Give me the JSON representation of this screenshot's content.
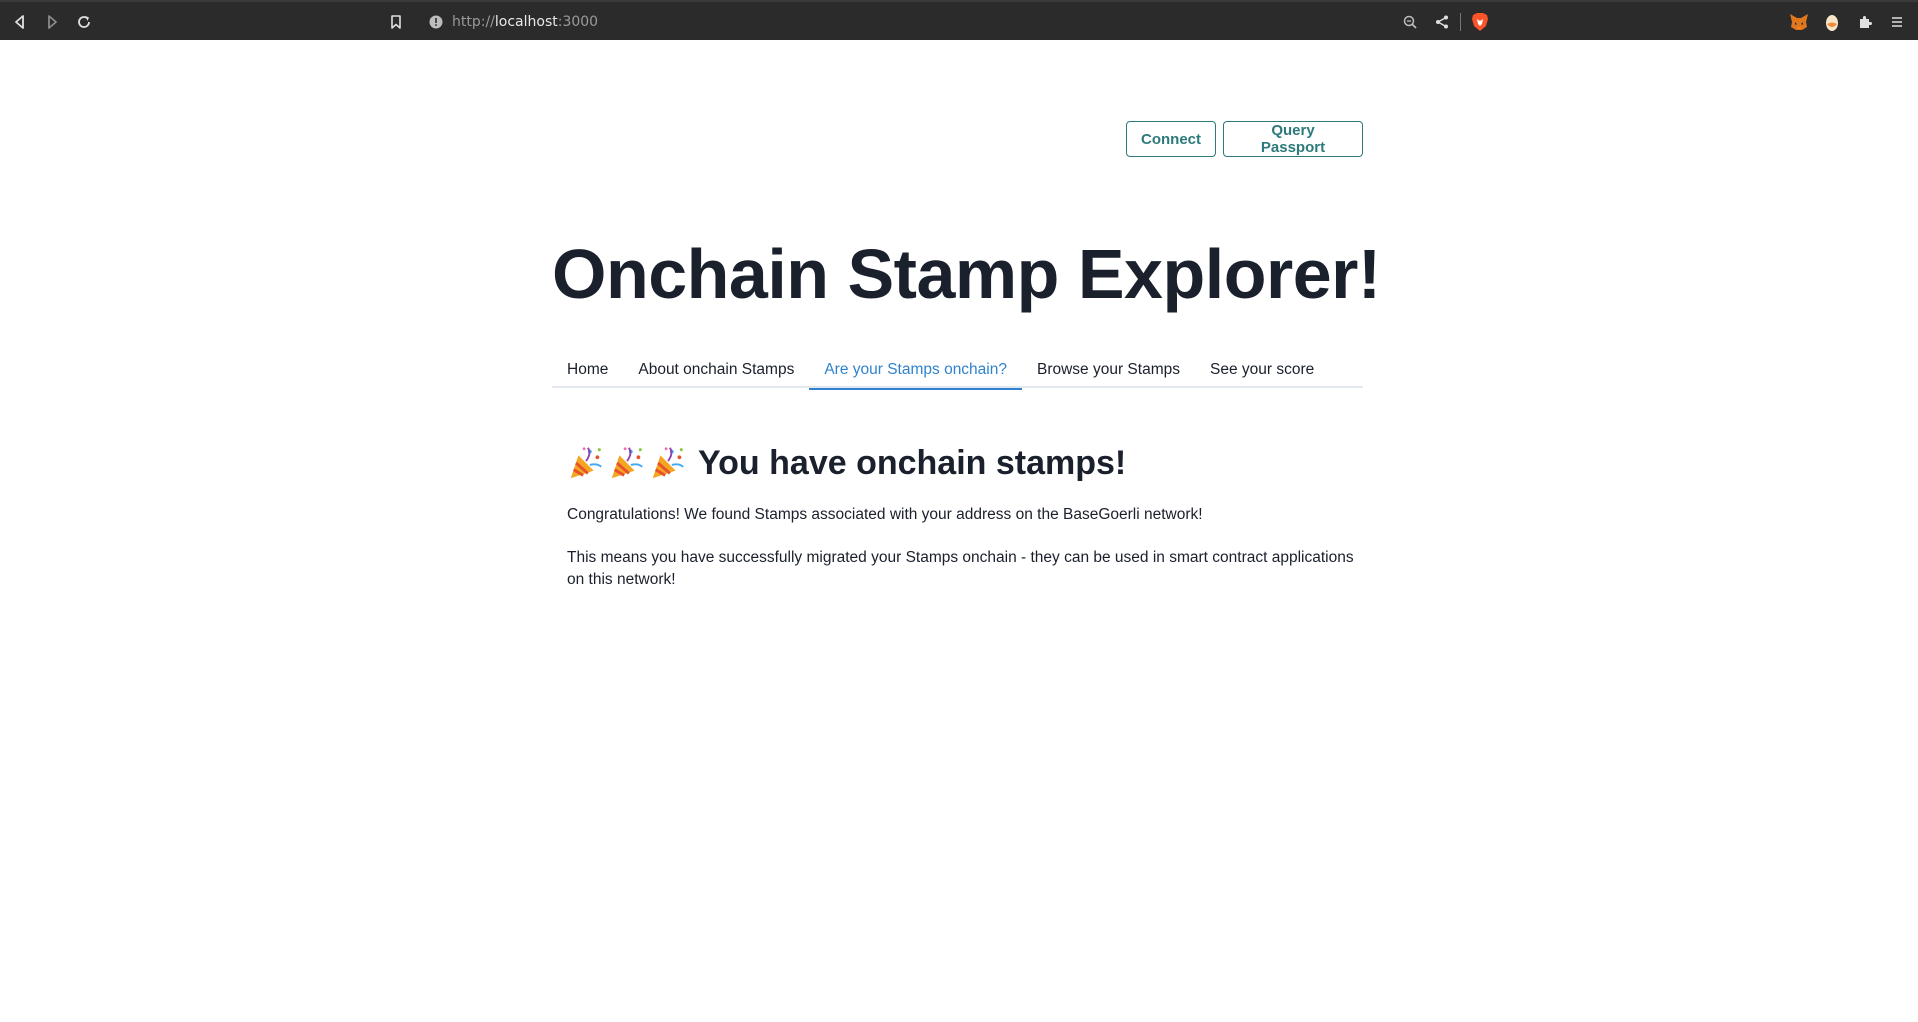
{
  "browser": {
    "url_scheme": "http://",
    "url_host": "localhost",
    "url_port": ":3000",
    "icons": [
      "back-icon",
      "forward-icon",
      "reload-icon",
      "bookmark-icon",
      "site-info-icon",
      "zoom-icon",
      "share-icon",
      "brave-shields-icon",
      "metamask-icon",
      "extension-egg-icon",
      "extensions-puzzle-icon",
      "menu-icon"
    ]
  },
  "header": {
    "connect_label": "Connect",
    "query_label": "Query Passport"
  },
  "page": {
    "title": "Onchain Stamp Explorer!"
  },
  "tabs": [
    {
      "label": "Home",
      "active": false
    },
    {
      "label": "About onchain Stamps",
      "active": false
    },
    {
      "label": "Are your Stamps onchain?",
      "active": true
    },
    {
      "label": "Browse your Stamps",
      "active": false
    },
    {
      "label": "See your score",
      "active": false
    }
  ],
  "result": {
    "heading": "You have onchain stamps!",
    "emoji_icon": "party-popper-icon",
    "emoji_count": 3,
    "paragraph1": "Congratulations! We found Stamps associated with your address on the BaseGoerli network!",
    "paragraph2": "This means you have successfully migrated your Stamps onchain - they can be used in smart contract applications on this network!"
  },
  "colors": {
    "accent_teal": "#2c7a7b",
    "active_tab_blue": "#3182ce",
    "text_dark": "#1a202c",
    "chrome_bg": "#2b2b2b"
  }
}
